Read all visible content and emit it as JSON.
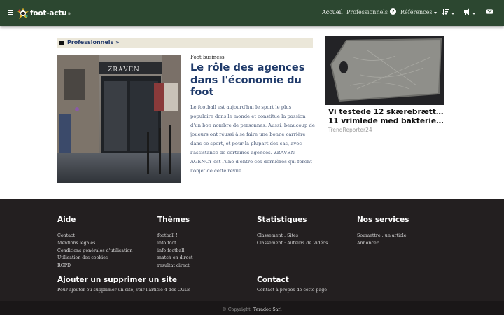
{
  "navbar": {
    "logo_text": "foot-actu",
    "logo_tld": ".fr",
    "links": [
      "Accueil",
      "Professionnels"
    ],
    "references_label": "Références",
    "icons": [
      "menu-icon",
      "help-icon",
      "sort-icon",
      "user-icon",
      "megaphone-icon",
      "mail-icon"
    ]
  },
  "section": {
    "label": "Professionnels »"
  },
  "article": {
    "category": "Foot business",
    "title": "Le rôle des agences dans l'économie du foot",
    "body": "Le football est aujourd'hui le sport le plus populaire dans le monde et constitue la passion d'un bon nombre de personnes. Aussi, beaucoup de joueurs ont réussi à se faire une bonne carrière dans ce sport, et pour la plupart des cas, avec l'assistance de certaines agences. ZRAVEN AGENCY est l'une d'entre ces dernières qui feront l'objet de cette revue.",
    "image_sign": "ZRAVEN"
  },
  "ad": {
    "title_line1": "Vi testede 12 skærebrætter.",
    "title_line2": "11 vrimlede med bakterier...",
    "source": "TrendReporter24"
  },
  "footer": {
    "aide": {
      "heading": "Aide",
      "items": [
        "Contact",
        "Mentions légales",
        "Conditions générales d'utilisation",
        "Utilisation des cookies",
        "RGPD"
      ]
    },
    "themes": {
      "heading": "Thèmes",
      "items": [
        "football !",
        "info foot",
        "info football",
        "match en direct",
        "resultat direct"
      ]
    },
    "stats": {
      "heading": "Statistiques",
      "items": [
        "Classement : Sites",
        "Classement : Auteurs de Vidéos"
      ]
    },
    "services": {
      "heading": "Nos services",
      "items": [
        "Soumettre : un article",
        "Annoncer"
      ]
    },
    "ajouter": {
      "heading": "Ajouter un supprimer un site",
      "text": "Pour ajouter ou supprimer un site, voir l'article 4 des CGUs"
    },
    "contact": {
      "heading": "Contact",
      "text": "Contact à propos de cette page"
    },
    "copyright_prefix": "© Copyright:",
    "copyright_owner": "Teradoc Sarl"
  },
  "colors": {
    "navbar": "#2c4730",
    "title": "#1f3a6a",
    "footer": "#231f20",
    "section_bar": "#ebe7d9"
  }
}
